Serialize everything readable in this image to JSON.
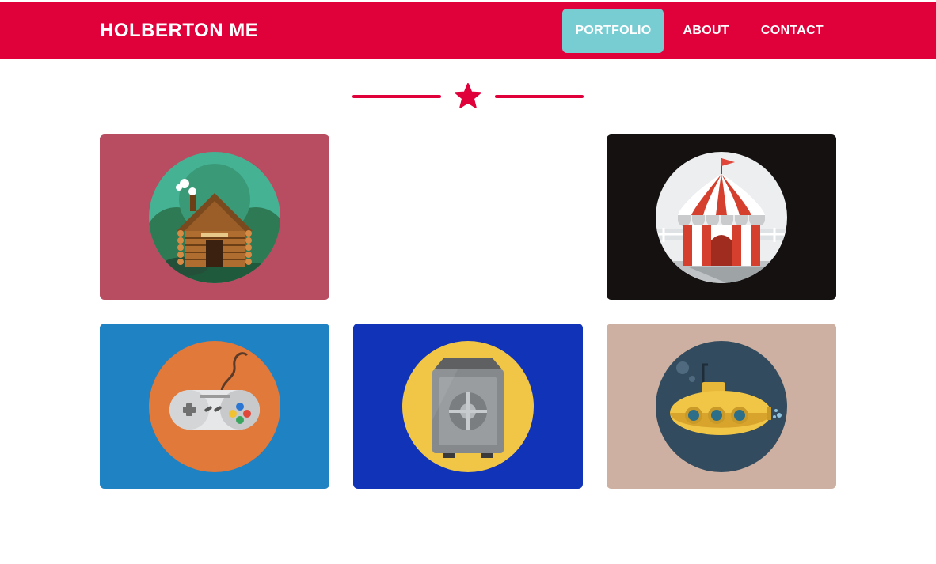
{
  "nav": {
    "brand": "HOLBERTON ME",
    "links": [
      {
        "label": "PORTFOLIO",
        "active": true
      },
      {
        "label": "ABOUT",
        "active": false
      },
      {
        "label": "CONTACT",
        "active": false
      }
    ]
  },
  "colors": {
    "brand": "#e0003a",
    "active_nav": "#78cdd3"
  },
  "divider": {
    "icon": "star-icon"
  },
  "portfolio": {
    "items": [
      {
        "icon": "log-cabin-icon",
        "background": "#b84d62"
      },
      {
        "icon": "circus-tent-icon",
        "background": "#141110"
      },
      {
        "icon": "gamepad-icon",
        "background": "#1f82c3"
      },
      {
        "icon": "safe-icon",
        "background": "#1133b8"
      },
      {
        "icon": "submarine-icon",
        "background": "#cdb0a1"
      }
    ]
  }
}
